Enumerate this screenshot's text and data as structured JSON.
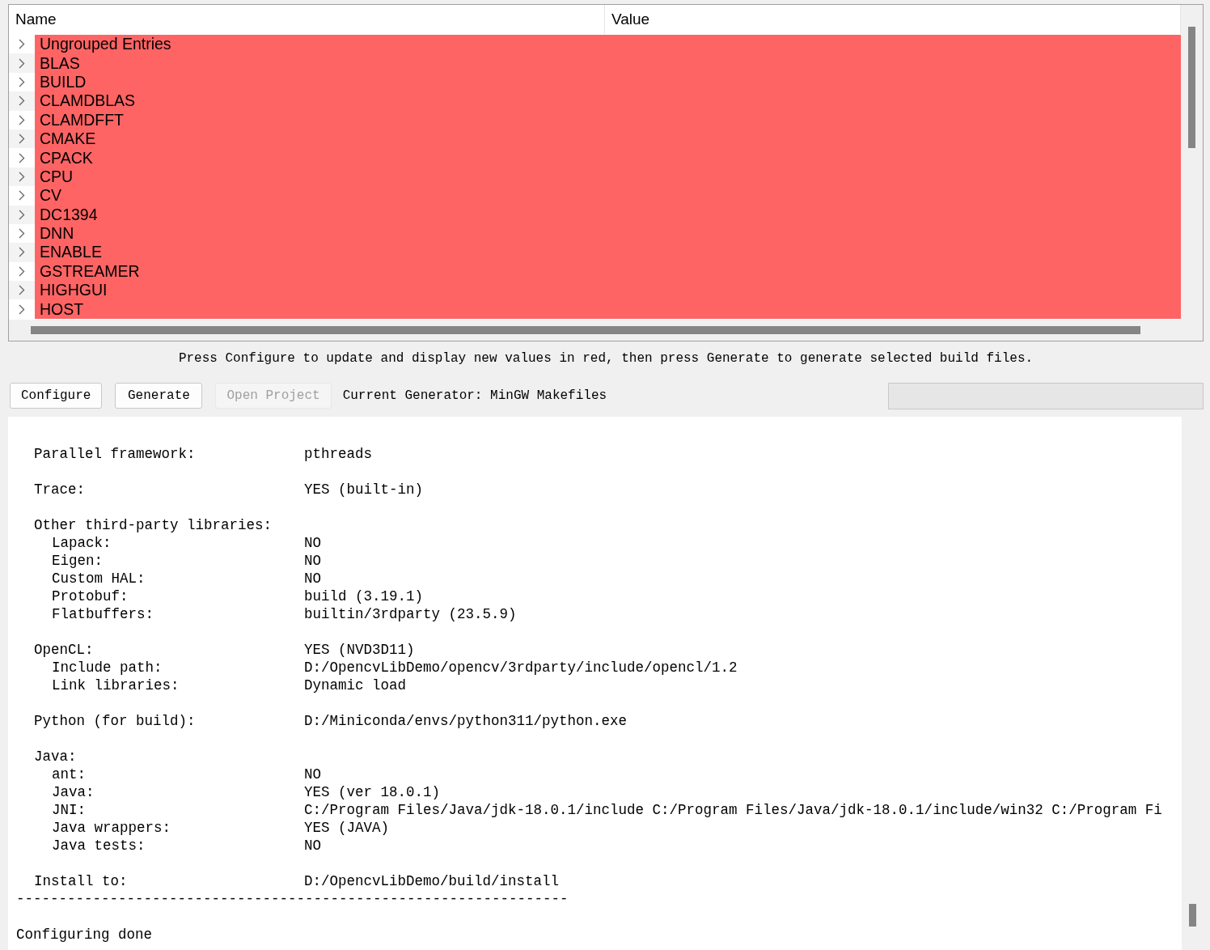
{
  "tree": {
    "columns": [
      "Name",
      "Value"
    ],
    "items": [
      {
        "name": "Ungrouped Entries",
        "new": true
      },
      {
        "name": "BLAS",
        "new": true
      },
      {
        "name": "BUILD",
        "new": true
      },
      {
        "name": "CLAMDBLAS",
        "new": true
      },
      {
        "name": "CLAMDFFT",
        "new": true
      },
      {
        "name": "CMAKE",
        "new": true
      },
      {
        "name": "CPACK",
        "new": true
      },
      {
        "name": "CPU",
        "new": true
      },
      {
        "name": "CV",
        "new": true
      },
      {
        "name": "DC1394",
        "new": true
      },
      {
        "name": "DNN",
        "new": true
      },
      {
        "name": "ENABLE",
        "new": true
      },
      {
        "name": "GSTREAMER",
        "new": true
      },
      {
        "name": "HIGHGUI",
        "new": true
      },
      {
        "name": "HOST",
        "new": true
      }
    ]
  },
  "hint": "Press Configure to update and display new values in red, then press Generate to generate selected build files.",
  "buttons": [
    {
      "label": "Configure",
      "disabled": false
    },
    {
      "label": "Generate",
      "disabled": false
    },
    {
      "label": "Open Project",
      "disabled": true
    }
  ],
  "generator": "Current Generator: MinGW Makefiles",
  "progress": {
    "level": 0
  },
  "log": {
    "entries": [
      {
        "label": "Parallel framework:",
        "value": "pthreads"
      },
      {
        "label": "Trace:",
        "value": "YES (built-in)"
      },
      {
        "label": "Other third-party libraries:",
        "children": [
          {
            "label": "Lapack:",
            "value": "NO"
          },
          {
            "label": "Eigen:",
            "value": "NO"
          },
          {
            "label": "Custom HAL:",
            "value": "NO"
          },
          {
            "label": "Protobuf:",
            "value": "build (3.19.1)"
          },
          {
            "label": "Flatbuffers:",
            "value": "builtin/3rdparty (23.5.9)"
          }
        ]
      },
      {
        "label": "OpenCL:",
        "value": "YES (NVD3D11)",
        "children": [
          {
            "label": "Include path:",
            "value": "D:/OpencvLibDemo/opencv/3rdparty/include/opencl/1.2"
          },
          {
            "label": "Link libraries:",
            "value": "Dynamic load"
          }
        ]
      },
      {
        "label": "Python (for build):",
        "value": "D:/Miniconda/envs/python311/python.exe"
      },
      {
        "label": "Java:",
        "children": [
          {
            "label": "ant:",
            "value": "NO"
          },
          {
            "label": "Java:",
            "value": "YES (ver 18.0.1)"
          },
          {
            "label": "JNI:",
            "value": "C:/Program Files/Java/jdk-18.0.1/include C:/Program Files/Java/jdk-18.0.1/include/win32 C:/Program Fi"
          },
          {
            "label": "Java wrappers:",
            "value": "YES (JAVA)"
          },
          {
            "label": "Java tests:",
            "value": "NO"
          }
        ]
      },
      {
        "label": "Install to:",
        "value": "D:/OpencvLibDemo/build/install"
      }
    ],
    "separator": "-----------------------------------------------------------------",
    "footer": "Configuring done"
  }
}
